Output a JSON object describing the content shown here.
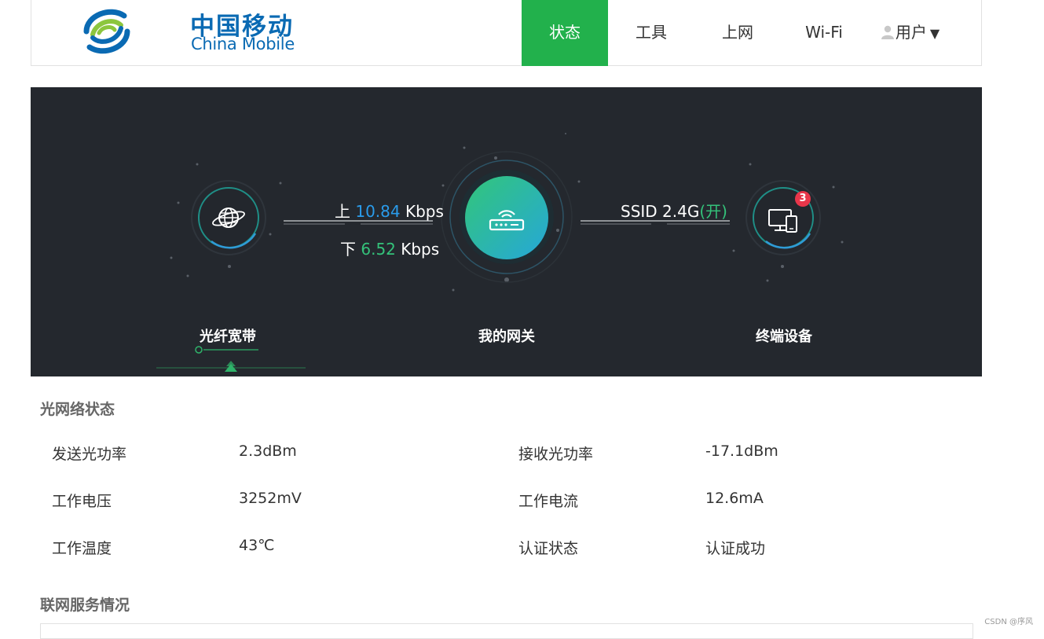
{
  "brand": {
    "name_cn": "中国移动",
    "name_en": "China Mobile",
    "colors": {
      "blue": "#0a6ab3",
      "green": "#8cc63e"
    }
  },
  "nav": {
    "items": [
      {
        "label": "状态",
        "active": true
      },
      {
        "label": "工具",
        "active": false
      },
      {
        "label": "上网",
        "active": false
      },
      {
        "label": "Wi-Fi",
        "active": false
      }
    ],
    "user": {
      "label": "用户",
      "caret": "▼",
      "icon": "user-icon"
    },
    "accent": "#22b14c"
  },
  "hero": {
    "upload": {
      "prefix": "上",
      "value": "10.84",
      "unit": "Kbps"
    },
    "download": {
      "prefix": "下",
      "value": "6.52",
      "unit": "Kbps"
    },
    "ssid": {
      "label": "SSID 2.4G",
      "state": "(开)"
    },
    "terminal_count": "3",
    "nodes": [
      {
        "label": "光纤宽带",
        "icon": "globe-icon",
        "selected": true
      },
      {
        "label": "我的网关",
        "icon": "router-icon",
        "selected": false
      },
      {
        "label": "终端设备",
        "icon": "devices-icon",
        "selected": false
      }
    ]
  },
  "optical_status": {
    "title": "光网络状态",
    "rows": [
      {
        "left_label": "发送光功率",
        "left_value": "2.3dBm",
        "right_label": "接收光功率",
        "right_value": "-17.1dBm"
      },
      {
        "left_label": "工作电压",
        "left_value": "3252mV",
        "right_label": "工作电流",
        "right_value": "12.6mA"
      },
      {
        "left_label": "工作温度",
        "left_value": "43℃",
        "right_label": "认证状态",
        "right_value": "认证成功"
      }
    ]
  },
  "service_status": {
    "title": "联网服务情况"
  },
  "watermark": "CSDN @序风"
}
